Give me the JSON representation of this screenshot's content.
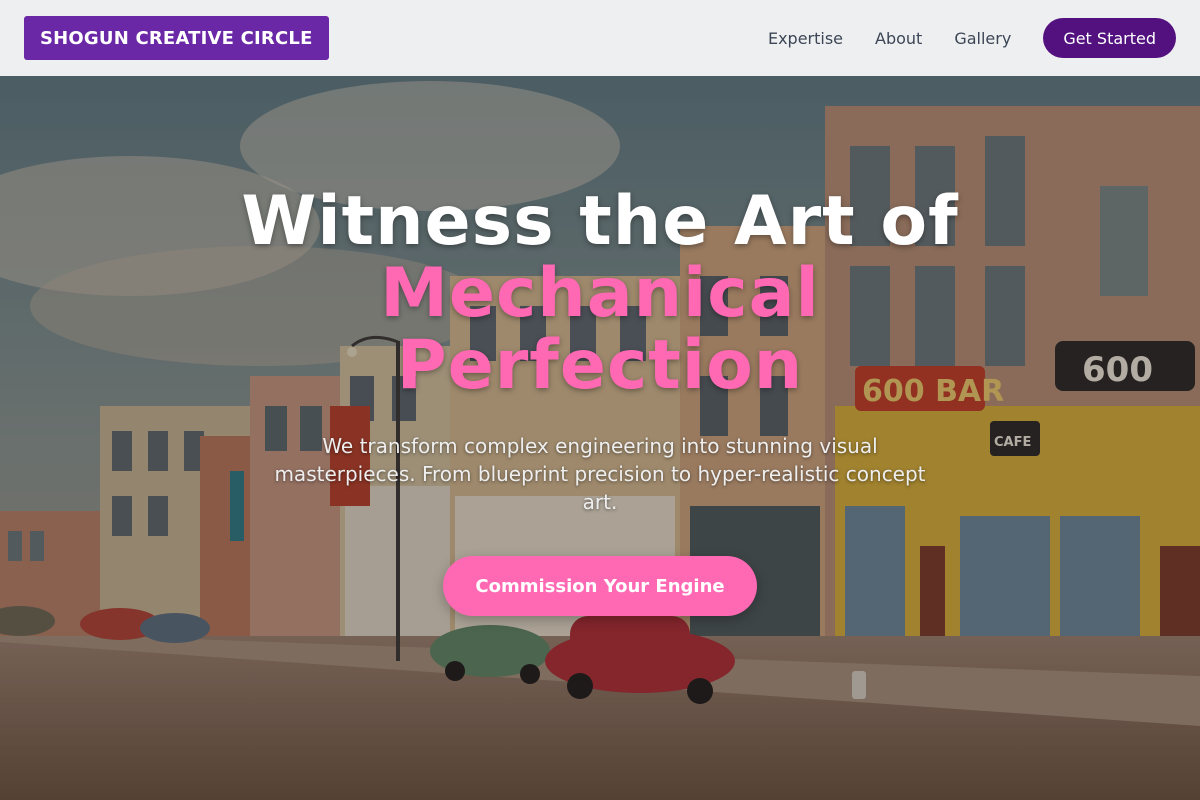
{
  "nav": {
    "logo": "SHOGUN CREATIVE CIRCLE",
    "links": [
      "Expertise",
      "About",
      "Gallery"
    ],
    "cta": "Get Started"
  },
  "hero": {
    "title_line1": "Witness the Art of",
    "title_accent_line1": "Mechanical",
    "title_accent_line2": "Perfection",
    "subtitle": "We transform complex engineering into stunning visual masterpieces. From blueprint precision to hyper-realistic concept art.",
    "cta": "Commission Your Engine",
    "background_image": "vintage-main-street-postcard"
  },
  "signs": {
    "bar": "600 BAR",
    "number": "600",
    "cafe": "CAFE"
  },
  "colors": {
    "logo_bg": "#6a28a6",
    "nav_cta_bg": "#52117e",
    "accent_pink": "#ff69b4",
    "nav_bg": "#eeeff0"
  }
}
